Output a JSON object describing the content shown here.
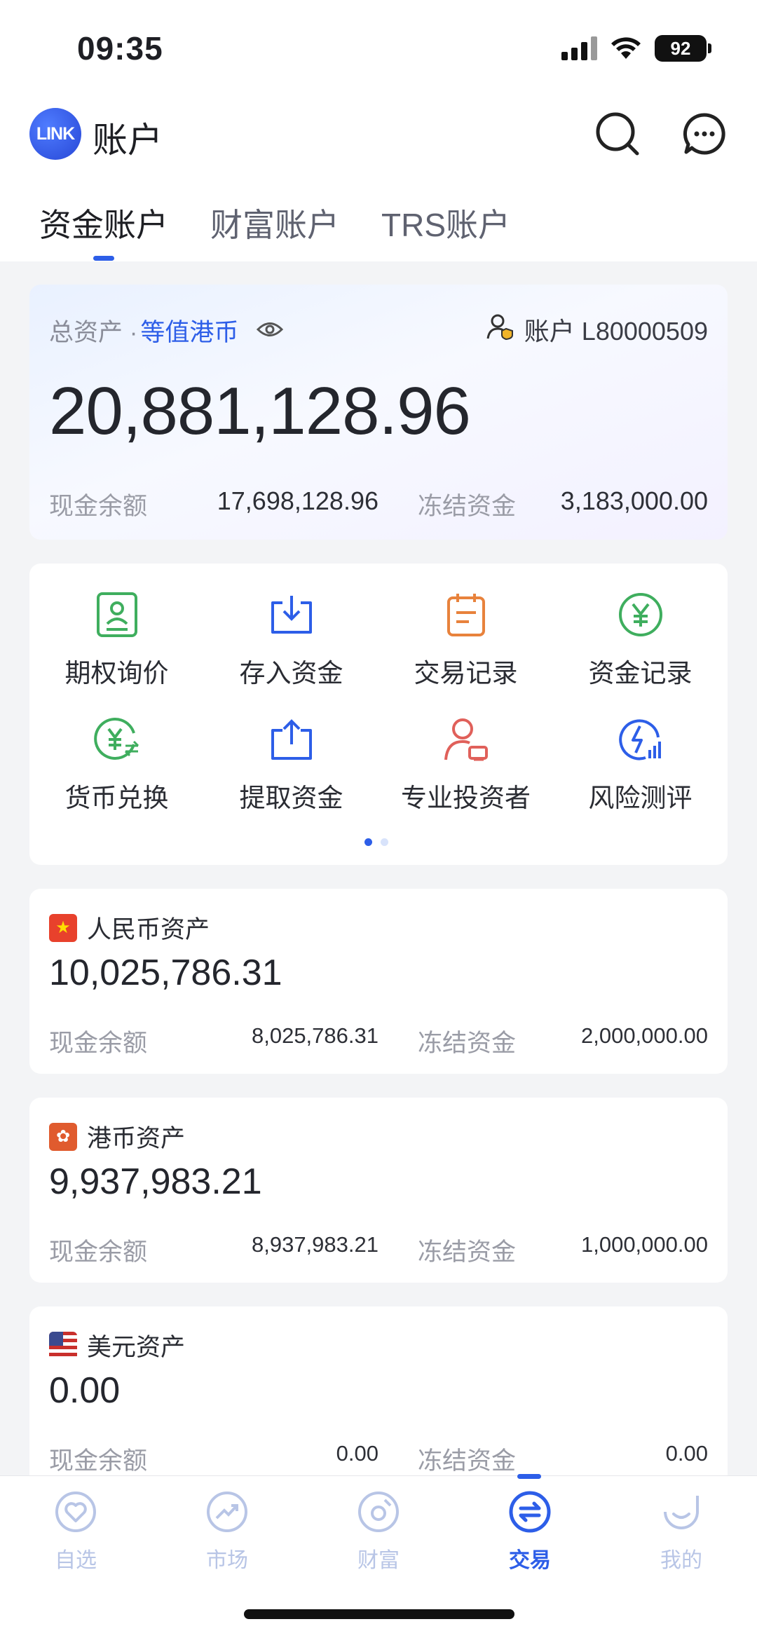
{
  "status_bar": {
    "time": "09:35",
    "battery": "92"
  },
  "header": {
    "logo_text": "LINK",
    "title": "账户"
  },
  "tabs": [
    {
      "label": "资金账户",
      "active": true
    },
    {
      "label": "财富账户",
      "active": false
    },
    {
      "label": "TRS账户",
      "active": false
    }
  ],
  "summary": {
    "label_prefix": "总资产 · ",
    "label_currency": "等值港币",
    "account_label": "账户 L80000509",
    "total": "20,881,128.96",
    "cash_label": "现金余额",
    "cash_value": "17,698,128.96",
    "frozen_label": "冻结资金",
    "frozen_value": "3,183,000.00"
  },
  "actions": [
    {
      "label": "期权询价",
      "icon": "contact-card-icon"
    },
    {
      "label": "存入资金",
      "icon": "download-tray-icon"
    },
    {
      "label": "交易记录",
      "icon": "calendar-record-icon"
    },
    {
      "label": "资金记录",
      "icon": "yuan-circle-icon"
    },
    {
      "label": "货币兑换",
      "icon": "currency-exchange-icon"
    },
    {
      "label": "提取资金",
      "icon": "upload-tray-icon"
    },
    {
      "label": "专业投资者",
      "icon": "pro-investor-icon"
    },
    {
      "label": "风险测评",
      "icon": "risk-bolt-icon"
    }
  ],
  "currencies": [
    {
      "name": "人民币资产",
      "amount": "10,025,786.31",
      "cash_label": "现金余额",
      "cash": "8,025,786.31",
      "frozen_label": "冻结资金",
      "frozen": "2,000,000.00",
      "flag_color": "#e8412c"
    },
    {
      "name": "港币资产",
      "amount": "9,937,983.21",
      "cash_label": "现金余额",
      "cash": "8,937,983.21",
      "frozen_label": "冻结资金",
      "frozen": "1,000,000.00",
      "flag_color": "#e05b2e"
    },
    {
      "name": "美元资产",
      "amount": "0.00",
      "cash_label": "现金余额",
      "cash": "0.00",
      "frozen_label": "冻结资金",
      "frozen": "0.00",
      "flag_color": "#3b4a8f"
    }
  ],
  "bottom_nav": [
    {
      "label": "自选",
      "icon": "heart-icon",
      "active": false
    },
    {
      "label": "市场",
      "icon": "trend-icon",
      "active": false
    },
    {
      "label": "财富",
      "icon": "wealth-icon",
      "active": false
    },
    {
      "label": "交易",
      "icon": "exchange-icon",
      "active": true
    },
    {
      "label": "我的",
      "icon": "smile-icon",
      "active": false
    }
  ],
  "colors": {
    "accent": "#2d5ee8",
    "green": "#3fae5e",
    "orange": "#e8823c",
    "red": "#e0605a"
  }
}
